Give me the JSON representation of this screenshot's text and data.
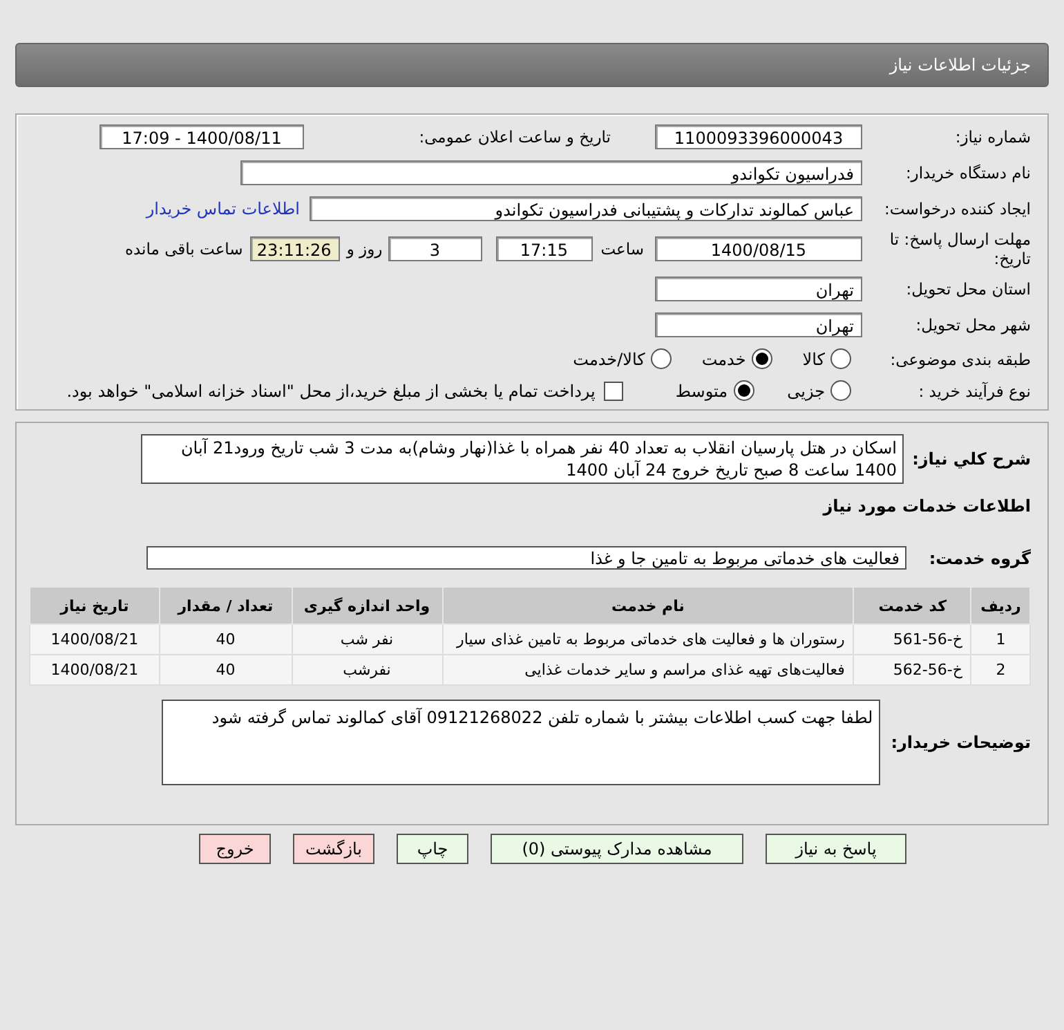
{
  "header": {
    "title": "جزئیات اطلاعات نیاز"
  },
  "details": {
    "need_number": {
      "label": "شماره نیاز:",
      "value": "1100093396000043"
    },
    "announce": {
      "label": "تاریخ و ساعت اعلان عمومی:",
      "value": "1400/08/11 - 17:09"
    },
    "buyer_org": {
      "label": "نام دستگاه خریدار:",
      "value": "فدراسیون تکواندو"
    },
    "requester": {
      "label": "ایجاد کننده درخواست:",
      "value": "عباس کمالوند تدارکات و پشتیبانی فدراسیون تکواندو",
      "link": "اطلاعات تماس خریدار"
    },
    "deadline": {
      "label": "مهلت ارسال پاسخ: تا تاریخ:",
      "date": "1400/08/15",
      "time_label": "ساعت",
      "time": "17:15",
      "days": "3",
      "days_label": "روز و",
      "remaining": "23:11:26",
      "remaining_label": "ساعت باقی مانده"
    },
    "province": {
      "label": "استان محل تحویل:",
      "value": "تهران"
    },
    "city": {
      "label": "شهر محل تحویل:",
      "value": "تهران"
    },
    "category": {
      "label": "طبقه بندی موضوعی:",
      "options": [
        {
          "label": "کالا",
          "selected": false
        },
        {
          "label": "خدمت",
          "selected": true
        },
        {
          "label": "کالا/خدمت",
          "selected": false
        }
      ]
    },
    "process": {
      "label": "نوع فرآیند خرید :",
      "options": [
        {
          "label": "جزیی",
          "selected": false
        },
        {
          "label": "متوسط",
          "selected": true
        }
      ],
      "payment": {
        "label": "پرداخت تمام یا بخشی از مبلغ خرید،از محل \"اسناد خزانه اسلامی\" خواهد بود.",
        "checked": false
      }
    }
  },
  "need": {
    "summary": {
      "label": "شرح کلي نياز:",
      "value": "اسکان در هتل پارسیان انقلاب به تعداد 40 نفر همراه با غذا(نهار وشام)به مدت 3 شب تاریخ ورود21 آبان 1400 ساعت 8 صبح تاریخ خروج 24 آبان 1400"
    },
    "services_heading": "اطلاعات خدمات مورد نیاز",
    "service_group": {
      "label": "گروه خدمت:",
      "value": "فعالیت های خدماتی مربوط به تامین جا و غذا"
    },
    "table": {
      "columns": [
        "ردیف",
        "کد خدمت",
        "نام خدمت",
        "واحد اندازه گیری",
        "تعداد / مقدار",
        "تاریخ نیاز"
      ],
      "rows": [
        [
          "1",
          "خ-56-561",
          "رستوران ها و فعالیت های خدماتی مربوط به تامین غذای سیار",
          "نفر شب",
          "40",
          "1400/08/21"
        ],
        [
          "2",
          "خ-56-562",
          "فعالیت‌های تهیه غذای مراسم و سایر خدمات غذایی",
          "نفرشب",
          "40",
          "1400/08/21"
        ]
      ]
    },
    "buyer_notes": {
      "label": "توضیحات خریدار:",
      "value": "لطفا جهت کسب اطلاعات بیشتر با شماره تلفن 09121268022 آقای کمالوند تماس گرفته شود"
    }
  },
  "buttons": [
    {
      "label": "پاسخ به نیاز",
      "kind": "primary"
    },
    {
      "label": "مشاهده مدارک پیوستی (0)",
      "kind": "primary"
    },
    {
      "label": "چاپ",
      "kind": "primary"
    },
    {
      "label": "بازگشت",
      "kind": "danger"
    },
    {
      "label": "خروج",
      "kind": "danger"
    }
  ]
}
